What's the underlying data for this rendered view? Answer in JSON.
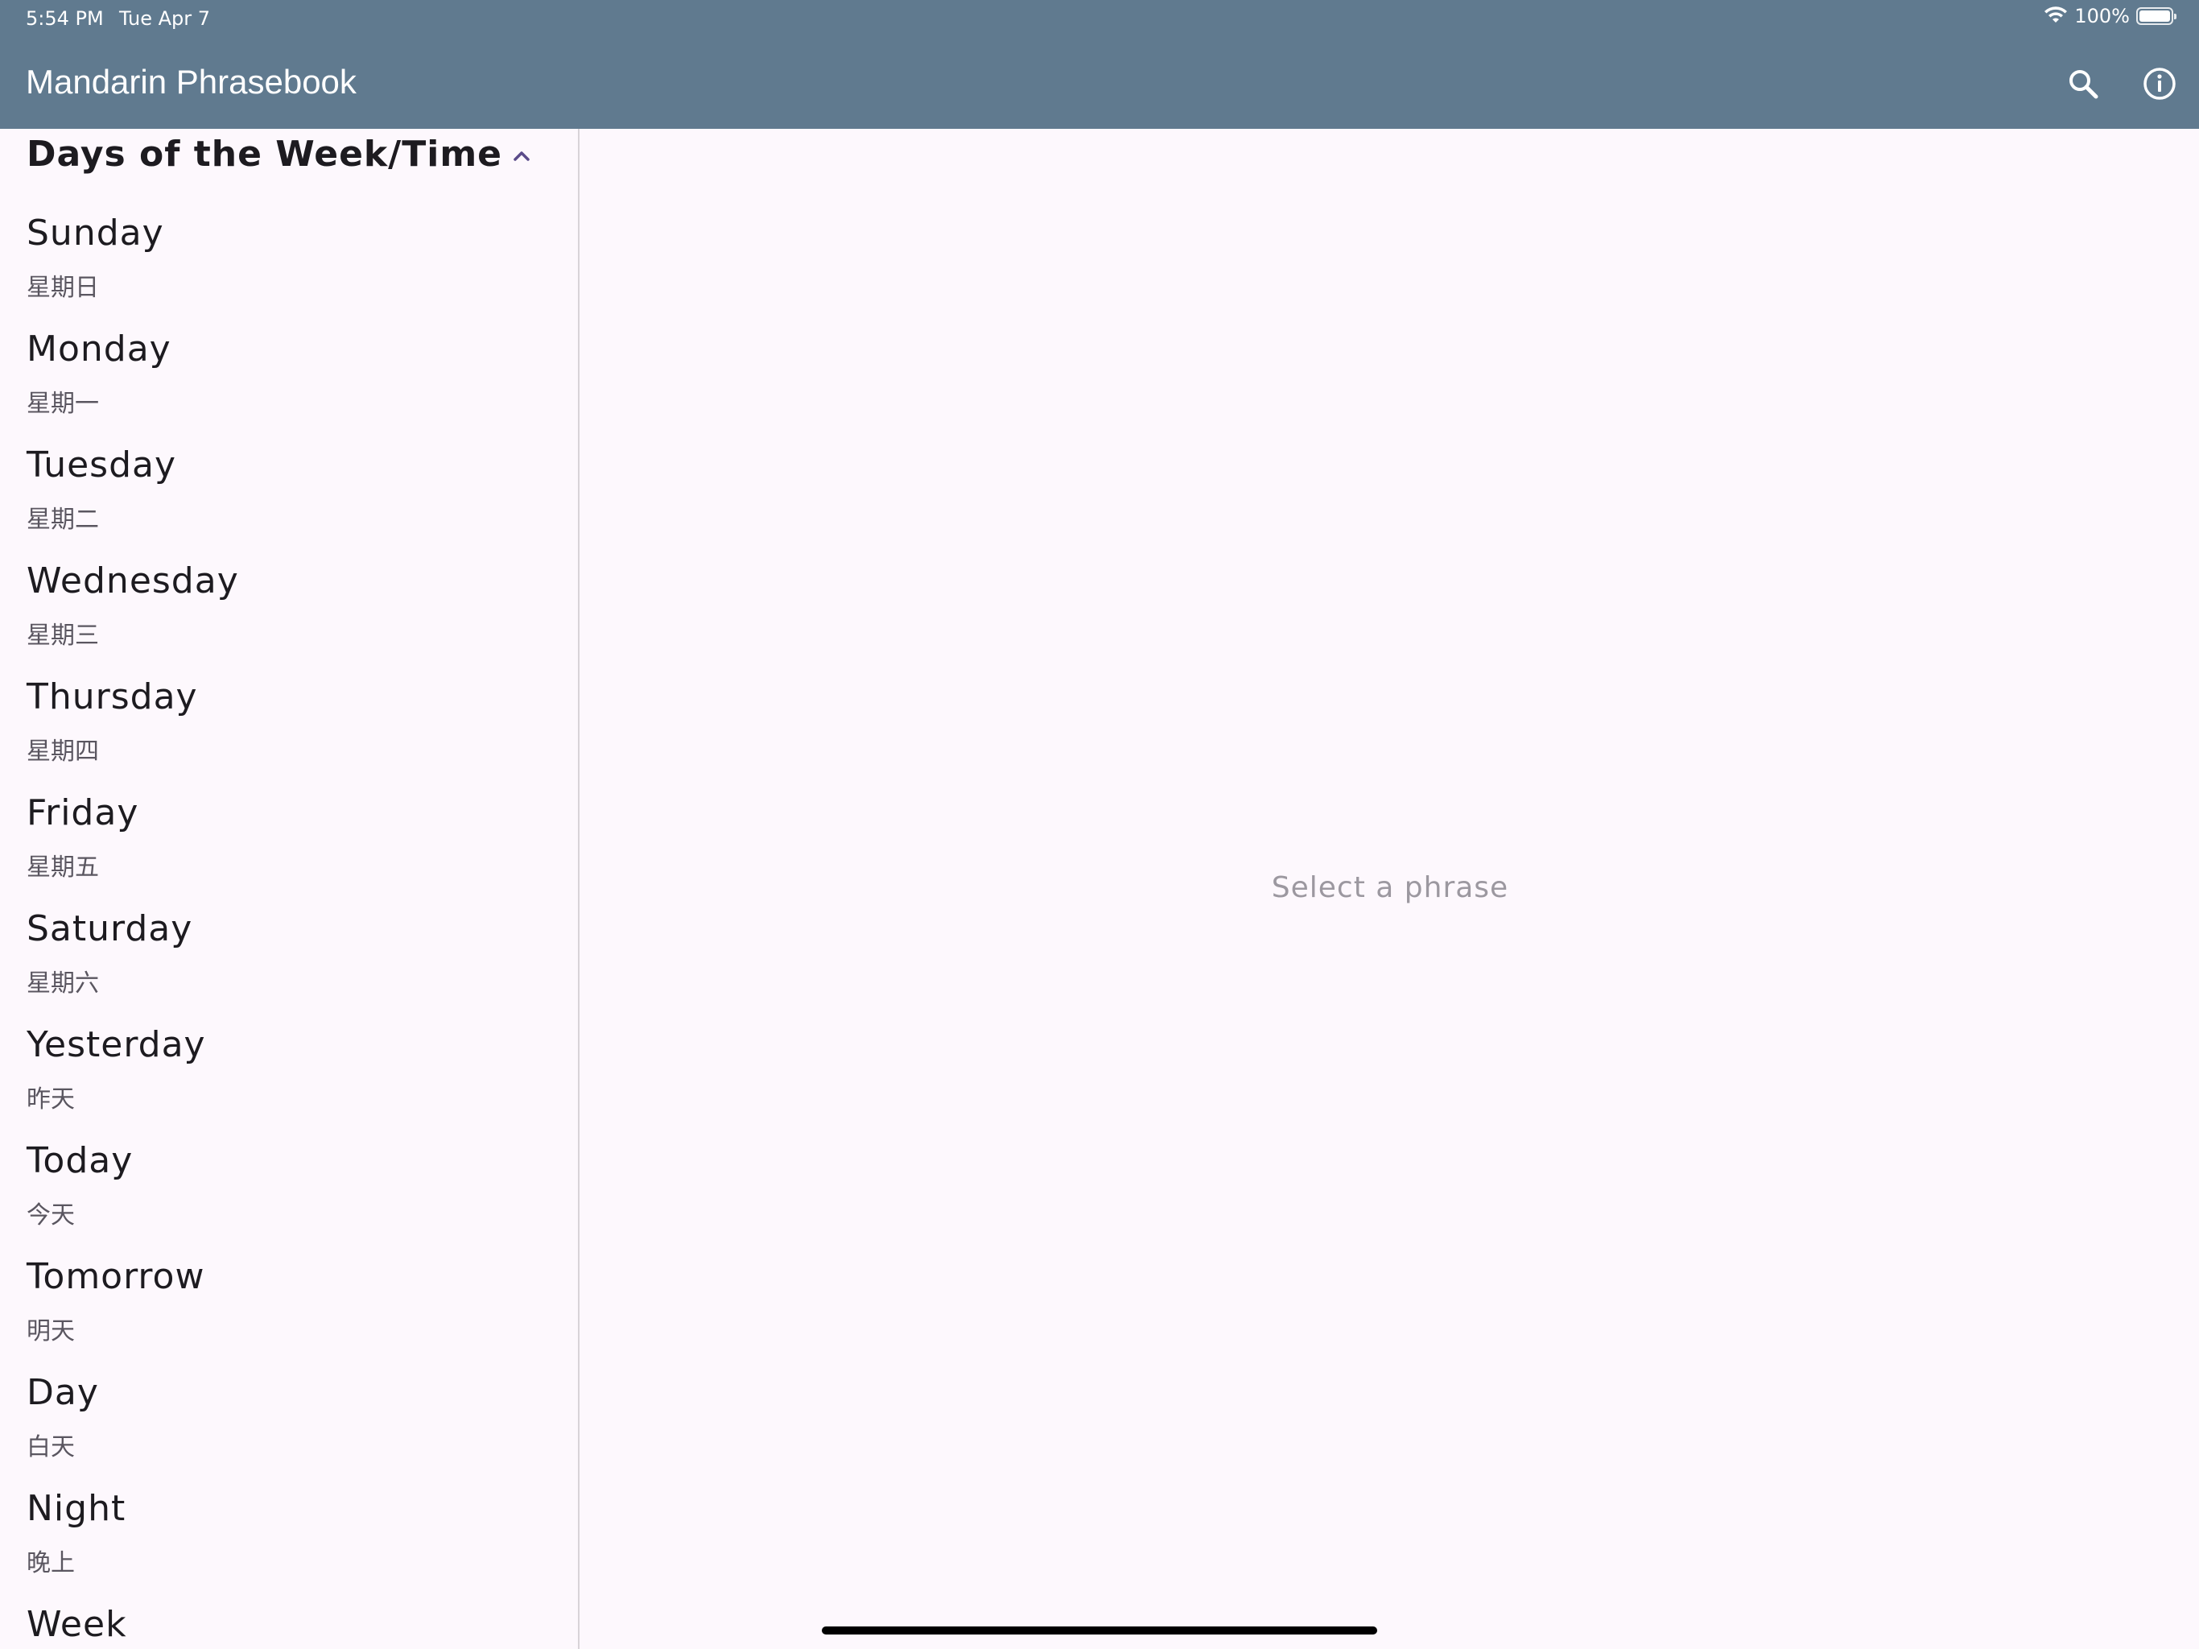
{
  "status_bar": {
    "time": "5:54 PM",
    "date": "Tue Apr 7",
    "battery": "100%"
  },
  "app_bar": {
    "title": "Mandarin Phrasebook",
    "actions": [
      "search-icon",
      "info-icon"
    ]
  },
  "sidebar": {
    "section_title": "Days of the Week/Time",
    "items": [
      {
        "english": "Sunday",
        "chinese": "星期日"
      },
      {
        "english": "Monday",
        "chinese": "星期一"
      },
      {
        "english": "Tuesday",
        "chinese": "星期二"
      },
      {
        "english": "Wednesday",
        "chinese": "星期三"
      },
      {
        "english": "Thursday",
        "chinese": "星期四"
      },
      {
        "english": "Friday",
        "chinese": "星期五"
      },
      {
        "english": "Saturday",
        "chinese": "星期六"
      },
      {
        "english": "Yesterday",
        "chinese": "昨天"
      },
      {
        "english": "Today",
        "chinese": "今天"
      },
      {
        "english": "Tomorrow",
        "chinese": "明天"
      },
      {
        "english": "Day",
        "chinese": "白天"
      },
      {
        "english": "Night",
        "chinese": "晚上"
      },
      {
        "english": "Week",
        "chinese": ""
      }
    ]
  },
  "detail": {
    "placeholder": "Select a phrase"
  },
  "colors": {
    "app_bar": "#607a8f",
    "background": "#fdf8fd",
    "accent": "#5b4b8a"
  }
}
